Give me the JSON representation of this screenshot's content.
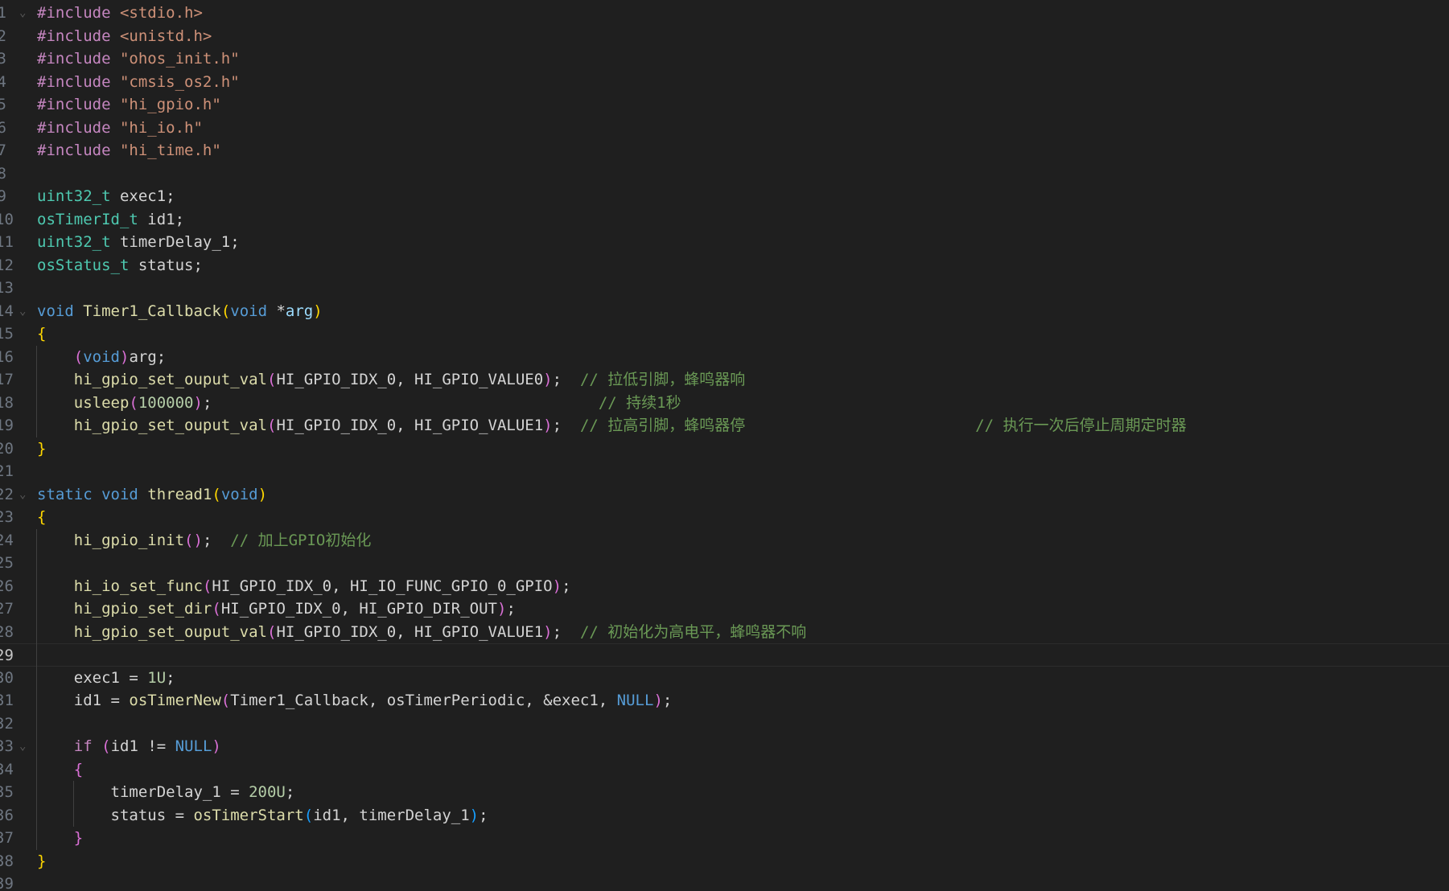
{
  "editor": {
    "colors": {
      "background": "#1f1f1f",
      "preprocessor": "#c586c0",
      "string": "#ce9178",
      "type": "#4ec9b0",
      "keyword": "#569cd6",
      "function": "#dcdcaa",
      "variable": "#9cdcfe",
      "number": "#b5cea8",
      "comment": "#6a9955",
      "bracket_1": "#ffd700",
      "bracket_2": "#da70d6",
      "bracket_3": "#179fff"
    },
    "current_line": 29,
    "lines": [
      {
        "n": "1",
        "fold": true,
        "tokens": [
          [
            "pp",
            "#include "
          ],
          [
            "str",
            "<stdio.h>"
          ]
        ]
      },
      {
        "n": "2",
        "tokens": [
          [
            "pp",
            "#include "
          ],
          [
            "str",
            "<unistd.h>"
          ]
        ]
      },
      {
        "n": "3",
        "tokens": [
          [
            "pp",
            "#include "
          ],
          [
            "str",
            "\"ohos_init.h\""
          ]
        ]
      },
      {
        "n": "4",
        "tokens": [
          [
            "pp",
            "#include "
          ],
          [
            "str",
            "\"cmsis_os2.h\""
          ]
        ]
      },
      {
        "n": "5",
        "tokens": [
          [
            "pp",
            "#include "
          ],
          [
            "str",
            "\"hi_gpio.h\""
          ]
        ]
      },
      {
        "n": "6",
        "tokens": [
          [
            "pp",
            "#include "
          ],
          [
            "str",
            "\"hi_io.h\""
          ]
        ]
      },
      {
        "n": "7",
        "tokens": [
          [
            "pp",
            "#include "
          ],
          [
            "str",
            "\"hi_time.h\""
          ]
        ]
      },
      {
        "n": "8",
        "tokens": []
      },
      {
        "n": "9",
        "tokens": [
          [
            "type",
            "uint32_t"
          ],
          [
            "def",
            " exec1;"
          ]
        ]
      },
      {
        "n": "10",
        "tokens": [
          [
            "type",
            "osTimerId_t"
          ],
          [
            "def",
            " id1;"
          ]
        ]
      },
      {
        "n": "11",
        "tokens": [
          [
            "type",
            "uint32_t"
          ],
          [
            "def",
            " timerDelay_1;"
          ]
        ]
      },
      {
        "n": "12",
        "tokens": [
          [
            "type",
            "osStatus_t"
          ],
          [
            "def",
            " status;"
          ]
        ]
      },
      {
        "n": "13",
        "tokens": []
      },
      {
        "n": "14",
        "fold": true,
        "tokens": [
          [
            "kw",
            "void"
          ],
          [
            "def",
            " "
          ],
          [
            "fn",
            "Timer1_Callback"
          ],
          [
            "p1",
            "("
          ],
          [
            "kw",
            "void"
          ],
          [
            "def",
            " *"
          ],
          [
            "var",
            "arg"
          ],
          [
            "p1",
            ")"
          ]
        ]
      },
      {
        "n": "15",
        "tokens": [
          [
            "p1",
            "{"
          ]
        ]
      },
      {
        "n": "16",
        "tokens": [
          [
            "def",
            "    "
          ],
          [
            "p2",
            "("
          ],
          [
            "kw",
            "void"
          ],
          [
            "p2",
            ")"
          ],
          [
            "def",
            "arg;"
          ]
        ]
      },
      {
        "n": "17",
        "tokens": [
          [
            "def",
            "    "
          ],
          [
            "fn",
            "hi_gpio_set_ouput_val"
          ],
          [
            "p2",
            "("
          ],
          [
            "def",
            "HI_GPIO_IDX_0, HI_GPIO_VALUE0"
          ],
          [
            "p2",
            ")"
          ],
          [
            "def",
            ";  "
          ],
          [
            "com",
            "// 拉低引脚，蜂鸣器响"
          ]
        ]
      },
      {
        "n": "18",
        "tokens": [
          [
            "def",
            "    "
          ],
          [
            "fn",
            "usleep"
          ],
          [
            "p2",
            "("
          ],
          [
            "num",
            "100000"
          ],
          [
            "p2",
            ")"
          ],
          [
            "def",
            ";                                          "
          ],
          [
            "com",
            "// 持续1秒"
          ]
        ]
      },
      {
        "n": "19",
        "tokens": [
          [
            "def",
            "    "
          ],
          [
            "fn",
            "hi_gpio_set_ouput_val"
          ],
          [
            "p2",
            "("
          ],
          [
            "def",
            "HI_GPIO_IDX_0, HI_GPIO_VALUE1"
          ],
          [
            "p2",
            ")"
          ],
          [
            "def",
            ";  "
          ],
          [
            "com",
            "// 拉高引脚，蜂鸣器停"
          ],
          [
            "def",
            "                         "
          ],
          [
            "com",
            "// 执行一次后停止周期定时器"
          ]
        ]
      },
      {
        "n": "20",
        "tokens": [
          [
            "p1",
            "}"
          ]
        ]
      },
      {
        "n": "21",
        "tokens": []
      },
      {
        "n": "22",
        "fold": true,
        "tokens": [
          [
            "kw",
            "static"
          ],
          [
            "def",
            " "
          ],
          [
            "kw",
            "void"
          ],
          [
            "def",
            " "
          ],
          [
            "fn",
            "thread1"
          ],
          [
            "p1",
            "("
          ],
          [
            "kw",
            "void"
          ],
          [
            "p1",
            ")"
          ]
        ]
      },
      {
        "n": "23",
        "tokens": [
          [
            "p1",
            "{"
          ]
        ]
      },
      {
        "n": "24",
        "tokens": [
          [
            "def",
            "    "
          ],
          [
            "fn",
            "hi_gpio_init"
          ],
          [
            "p2",
            "()"
          ],
          [
            "def",
            ";  "
          ],
          [
            "com",
            "// 加上GPIO初始化"
          ]
        ]
      },
      {
        "n": "25",
        "tokens": []
      },
      {
        "n": "26",
        "tokens": [
          [
            "def",
            "    "
          ],
          [
            "fn",
            "hi_io_set_func"
          ],
          [
            "p2",
            "("
          ],
          [
            "def",
            "HI_GPIO_IDX_0, HI_IO_FUNC_GPIO_0_GPIO"
          ],
          [
            "p2",
            ")"
          ],
          [
            "def",
            ";"
          ]
        ]
      },
      {
        "n": "27",
        "tokens": [
          [
            "def",
            "    "
          ],
          [
            "fn",
            "hi_gpio_set_dir"
          ],
          [
            "p2",
            "("
          ],
          [
            "def",
            "HI_GPIO_IDX_0, HI_GPIO_DIR_OUT"
          ],
          [
            "p2",
            ")"
          ],
          [
            "def",
            ";"
          ]
        ]
      },
      {
        "n": "28",
        "tokens": [
          [
            "def",
            "    "
          ],
          [
            "fn",
            "hi_gpio_set_ouput_val"
          ],
          [
            "p2",
            "("
          ],
          [
            "def",
            "HI_GPIO_IDX_0, HI_GPIO_VALUE1"
          ],
          [
            "p2",
            ")"
          ],
          [
            "def",
            ";  "
          ],
          [
            "com",
            "// 初始化为高电平，蜂鸣器不响"
          ]
        ]
      },
      {
        "n": "29",
        "tokens": []
      },
      {
        "n": "30",
        "tokens": [
          [
            "def",
            "    exec1 = "
          ],
          [
            "num",
            "1U"
          ],
          [
            "def",
            ";"
          ]
        ]
      },
      {
        "n": "31",
        "tokens": [
          [
            "def",
            "    id1 = "
          ],
          [
            "fn",
            "osTimerNew"
          ],
          [
            "p2",
            "("
          ],
          [
            "def",
            "Timer1_Callback, osTimerPeriodic, &exec1, "
          ],
          [
            "kw",
            "NULL"
          ],
          [
            "p2",
            ")"
          ],
          [
            "def",
            ";"
          ]
        ]
      },
      {
        "n": "32",
        "tokens": []
      },
      {
        "n": "33",
        "fold": true,
        "tokens": [
          [
            "def",
            "    "
          ],
          [
            "ctrl",
            "if"
          ],
          [
            "def",
            " "
          ],
          [
            "p2",
            "("
          ],
          [
            "def",
            "id1 != "
          ],
          [
            "kw",
            "NULL"
          ],
          [
            "p2",
            ")"
          ]
        ]
      },
      {
        "n": "34",
        "tokens": [
          [
            "def",
            "    "
          ],
          [
            "p2",
            "{"
          ]
        ]
      },
      {
        "n": "35",
        "tokens": [
          [
            "def",
            "        timerDelay_1 = "
          ],
          [
            "num",
            "200U"
          ],
          [
            "def",
            ";"
          ]
        ]
      },
      {
        "n": "36",
        "tokens": [
          [
            "def",
            "        status = "
          ],
          [
            "fn",
            "osTimerStart"
          ],
          [
            "p3",
            "("
          ],
          [
            "def",
            "id1, timerDelay_1"
          ],
          [
            "p3",
            ")"
          ],
          [
            "def",
            ";"
          ]
        ]
      },
      {
        "n": "37",
        "tokens": [
          [
            "def",
            "    "
          ],
          [
            "p2",
            "}"
          ]
        ]
      },
      {
        "n": "38",
        "tokens": [
          [
            "p1",
            "}"
          ]
        ]
      },
      {
        "n": "39",
        "tokens": []
      }
    ]
  }
}
